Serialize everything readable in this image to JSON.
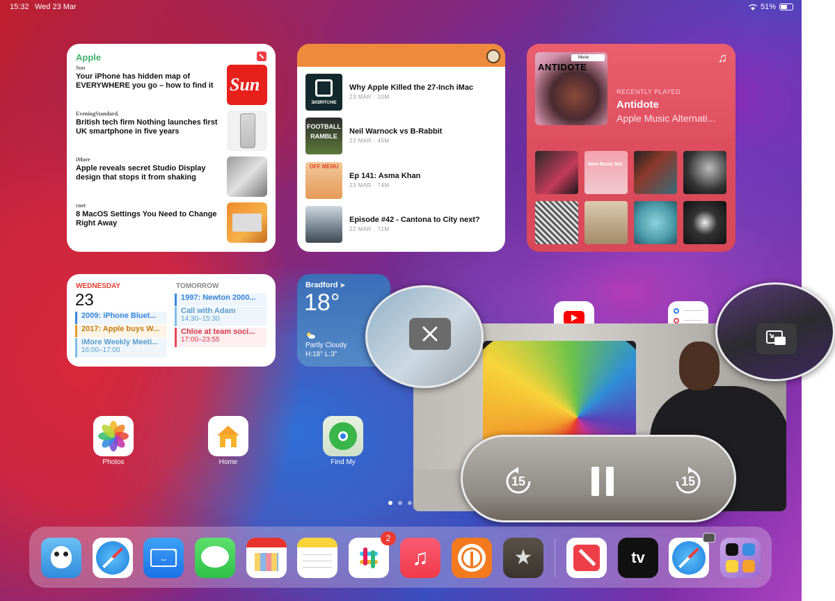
{
  "status_bar": {
    "time": "15:32",
    "date": "Wed 23 Mar",
    "battery": "51%"
  },
  "news_widget": {
    "header": "Apple",
    "items": [
      {
        "source": "Sun",
        "title": "Your iPhone has hidden map of EVERYWHERE you go – how to find it"
      },
      {
        "source": "EveningStandard.",
        "title": "British tech firm Nothing launches first UK smartphone in five years"
      },
      {
        "source": "iMore",
        "title": "Apple reveals secret Studio Display design that stops it from shaking"
      },
      {
        "source": "cnet",
        "title": "8 MacOS Settings You Need to Change Right Away"
      }
    ]
  },
  "podcast_widget": {
    "items": [
      {
        "title": "Why Apple Killed the 27-Inch iMac",
        "meta": "23 MAR · 10M",
        "art_text": "ƎИƎRITCHIE"
      },
      {
        "title": "Neil Warnock vs B-Rabbit",
        "meta": "23 MAR · 45M",
        "art_text": "FOOTBALL RAMBLE"
      },
      {
        "title": "Ep 141: Asma Khan",
        "meta": "23 MAR · 74M",
        "art_text": "OFF MENU"
      },
      {
        "title": "Episode #42 - Cantona to City next?",
        "meta": "22 MAR · 71M",
        "art_text": ""
      }
    ]
  },
  "music_widget": {
    "album_badge": "Music",
    "album_name": "ANTIDOTE",
    "recently_played_label": "RECENTLY PLAYED",
    "title": "Antidote",
    "subtitle": "Apple Music Alternati...",
    "grid_tile_label": "New Music Mix"
  },
  "calendar_widget": {
    "today_label": "WEDNESDAY",
    "today_date": "23",
    "tomorrow_label": "TOMORROW",
    "today_events": [
      {
        "title": "2009: iPhone Bluet...",
        "color": "#3a86d9"
      },
      {
        "title": "2017: Apple buys W...",
        "color": "#e39a2d"
      },
      {
        "title": "iMore Weekly Meeti...",
        "time": "16:00–17:00",
        "color": "#7fbde8"
      }
    ],
    "tomorrow_events": [
      {
        "title": "1997: Newton 2000...",
        "color": "#3a86d9"
      },
      {
        "title": "Call with Adam",
        "time": "14:30–15:30",
        "color": "#7fbde8"
      },
      {
        "title": "Chloe at team soci...",
        "time": "17:00–23:55",
        "color": "#e2475a"
      }
    ]
  },
  "weather_widget": {
    "city": "Bradford",
    "temp": "18°",
    "condition": "Partly Cloudy",
    "high_low": "H:18° L:3°"
  },
  "home_apps": [
    {
      "label": "Photos"
    },
    {
      "label": "Home"
    },
    {
      "label": "Find My"
    }
  ],
  "pip": {
    "skip_back": "15",
    "skip_forward": "15"
  },
  "dock": {
    "slack_badge": "2",
    "tv_label": "tv"
  },
  "colors": {
    "news_accent": "#3fb26a",
    "podcast_header": "#ef8a3c",
    "music_bg": "#df5060",
    "calendar_today": "#e23b30"
  }
}
